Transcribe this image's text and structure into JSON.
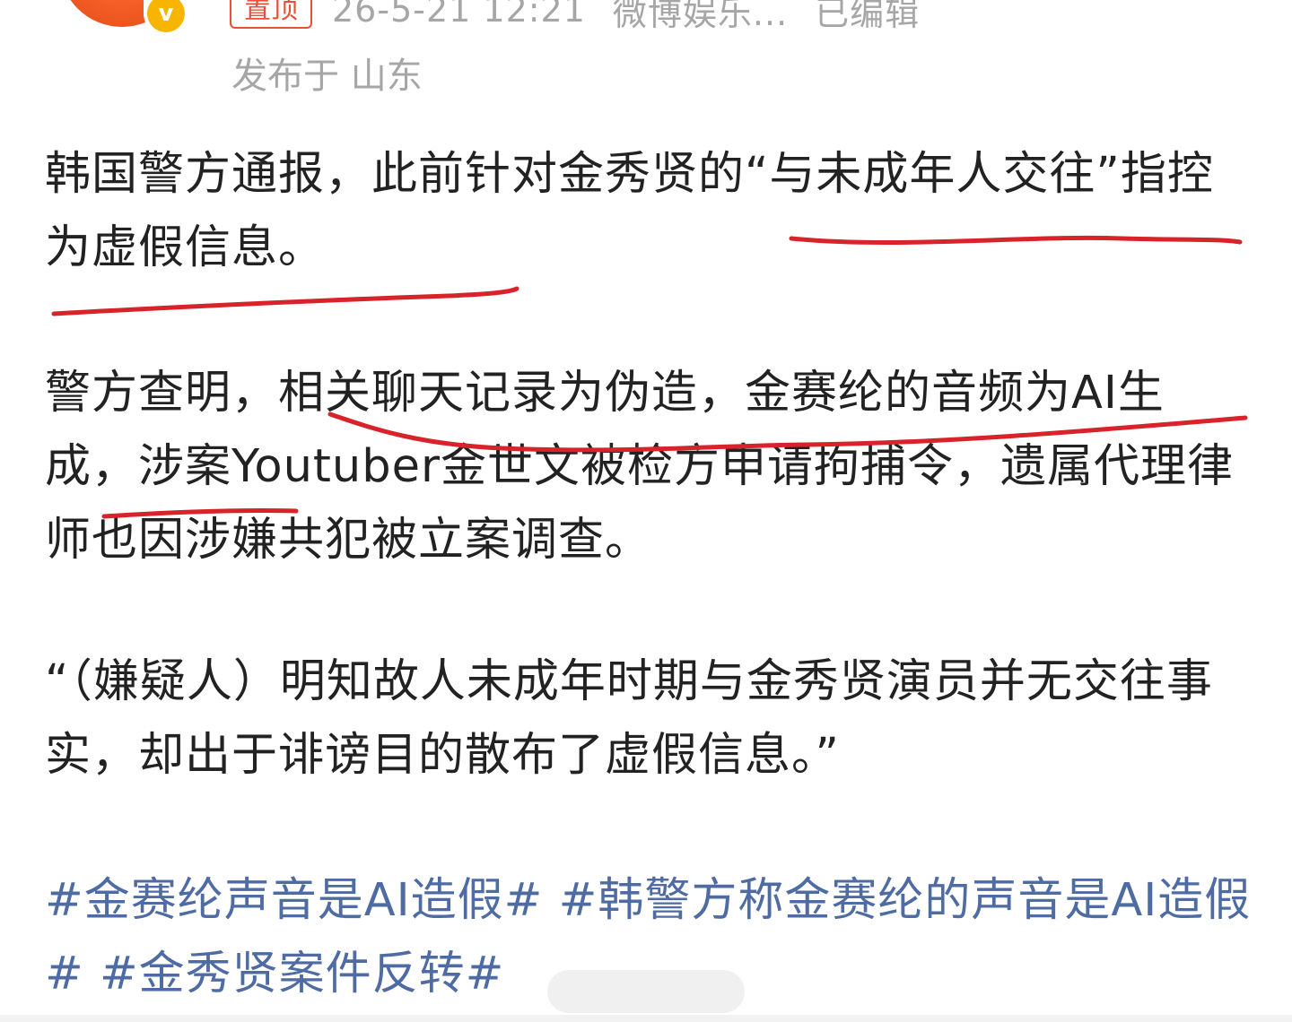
{
  "header": {
    "pin_label": "置顶",
    "timestamp": "26-5-21 12:21",
    "source": "微博娱乐...",
    "edited_label": "已编辑",
    "location": "发布于 山东"
  },
  "post": {
    "paragraph_1": "韩国警方通报，此前针对金秀贤的“与未成年人交往”指控为虚假信息。",
    "paragraph_2": "警方查明，相关聊天记录为伪造，金赛纶的音频为AI生成，涉案Youtuber金世文被检方申请拘捕令，遗属代理律师也因涉嫌共犯被立案调查。",
    "paragraph_3": "“（嫌疑人）明知故人未成年时期与金秀贤演员并无交往事实，却出于诽谤目的散布了虚假信息。”",
    "hashtags": [
      "#金赛纶声音是AI造假#",
      "#韩警方称金赛纶的声音是AI造假#",
      "#金秀贤案件反转#"
    ]
  },
  "colors": {
    "text": "#222222",
    "meta": "#a6a6a6",
    "hashtag": "#4e6ca3",
    "pin": "#e8503a",
    "annotation": "#d8232a",
    "avatar": "#f15a22",
    "verified": "#f7b500"
  },
  "icons": {
    "avatar": "weibo-entertainment-avatar",
    "verified": "verified-v-badge-icon"
  }
}
